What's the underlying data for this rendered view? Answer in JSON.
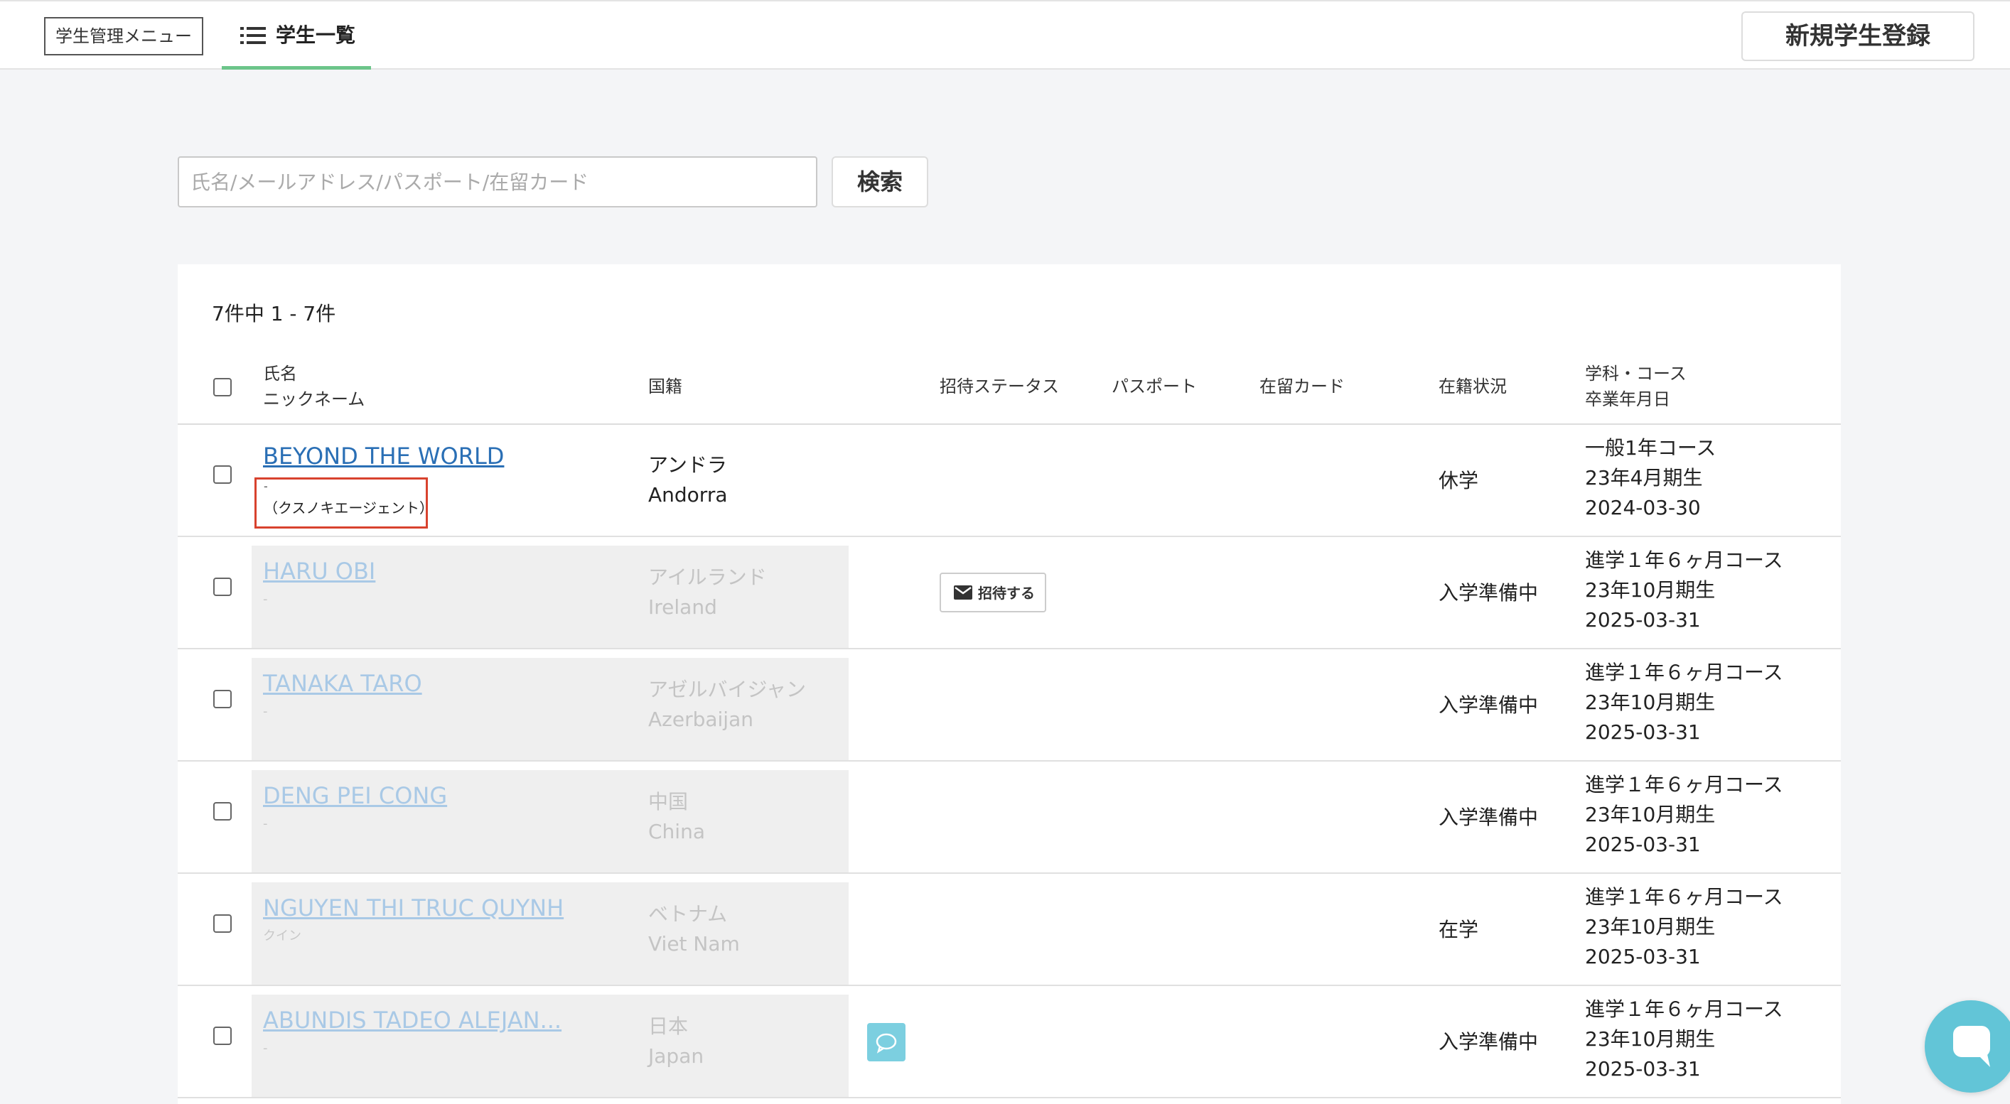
{
  "header": {
    "menu_label": "学生管理メニュー",
    "active_tab": "学生一覧",
    "new_button": "新規学生登録"
  },
  "search": {
    "placeholder": "氏名/メールアドレス/パスポート/在留カード",
    "button": "検索"
  },
  "table": {
    "count_text": "7件中 1 - 7件",
    "columns": {
      "name": "氏名",
      "nickname": "ニックネーム",
      "nationality": "国籍",
      "invite_status": "招待ステータス",
      "passport": "パスポート",
      "residence_card": "在留カード",
      "enrollment": "在籍状況",
      "course": "学科・コース",
      "graduation": "卒業年月日"
    },
    "rows": [
      {
        "name": "BEYOND THE WORLD",
        "nickname": "-",
        "agent": "（クスノキエージェント）",
        "nationality_ja": "アンドラ",
        "nationality_en": "Andorra",
        "status": "休学",
        "course": "一般1年コース",
        "term": "23年4月期生",
        "graduation": "2024-03-30"
      },
      {
        "name": "HARU OBI",
        "nickname": "-",
        "nationality_ja": "アイルランド",
        "nationality_en": "Ireland",
        "invite_label": "招待する",
        "status": "入学準備中",
        "course": "進学１年６ヶ月コース",
        "term": "23年10月期生",
        "graduation": "2025-03-31"
      },
      {
        "name": "TANAKA TARO",
        "nickname": "-",
        "nationality_ja": "アゼルバイジャン",
        "nationality_en": "Azerbaijan",
        "status": "入学準備中",
        "course": "進学１年６ヶ月コース",
        "term": "23年10月期生",
        "graduation": "2025-03-31"
      },
      {
        "name": "DENG PEI CONG",
        "nickname": "-",
        "nationality_ja": "中国",
        "nationality_en": "China",
        "status": "入学準備中",
        "course": "進学１年６ヶ月コース",
        "term": "23年10月期生",
        "graduation": "2025-03-31"
      },
      {
        "name": "NGUYEN THI TRUC QUYNH",
        "nickname": "クイン",
        "nationality_ja": "ベトナム",
        "nationality_en": "Viet Nam",
        "status": "在学",
        "course": "進学１年６ヶ月コース",
        "term": "23年10月期生",
        "graduation": "2025-03-31"
      },
      {
        "name": "ABUNDIS TADEO ALEJAN...",
        "nickname": "-",
        "nationality_ja": "日本",
        "nationality_en": "Japan",
        "status": "入学準備中",
        "course": "進学１年６ヶ月コース",
        "term": "23年10月期生",
        "graduation": "2025-03-31"
      }
    ]
  },
  "icons": {
    "list": "list-icon",
    "mail": "mail-icon",
    "chat": "chat-bubble-icon"
  },
  "colors": {
    "link": "#2a6fb5",
    "tab_underline": "#6cc58a",
    "highlight_box": "#d8422e",
    "chat": "#62c5d7"
  }
}
